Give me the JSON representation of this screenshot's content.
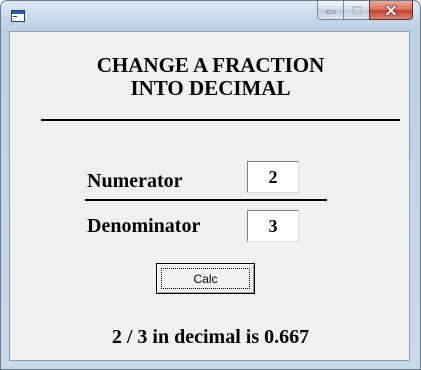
{
  "window": {
    "title": "",
    "controls": {
      "minimize_icon": "minimize-icon",
      "maximize_icon": "maximize-icon",
      "close_icon": "close-icon"
    }
  },
  "heading": {
    "line1": "CHANGE A FRACTION",
    "line2": "INTO DECIMAL"
  },
  "form": {
    "numerator_label": "Numerator",
    "numerator_value": "2",
    "denominator_label": "Denominator",
    "denominator_value": "3",
    "calc_label": "Calc"
  },
  "result": {
    "text": "2 / 3 in decimal is 0.667"
  },
  "colors": {
    "client_background": "#f0f0f0",
    "close_button": "#c0402a"
  }
}
